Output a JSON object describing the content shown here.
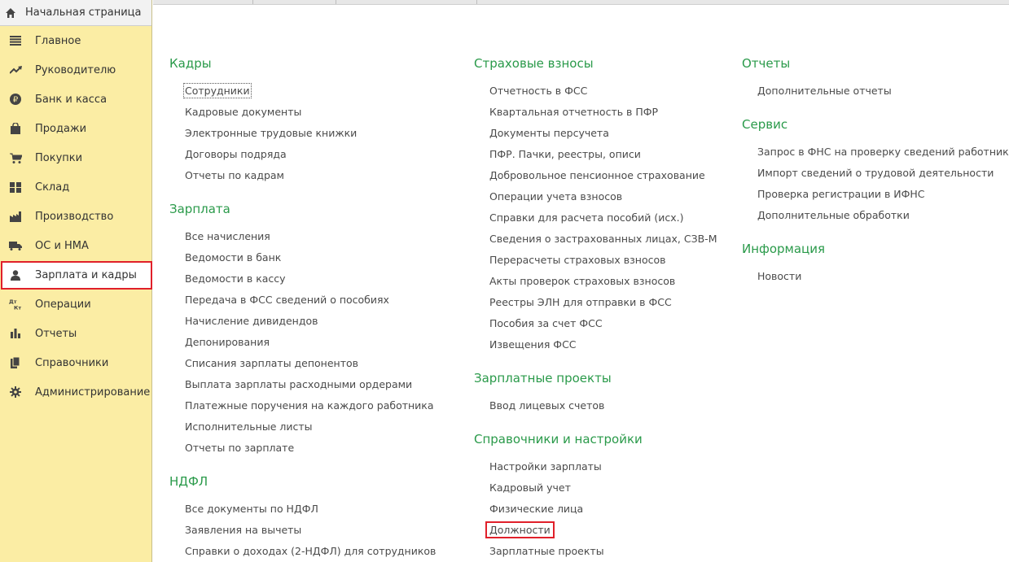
{
  "sidebar": {
    "home_label": "Начальная страница",
    "items": [
      {
        "label": "Главное",
        "icon": "menu-lines-icon"
      },
      {
        "label": "Руководителю",
        "icon": "trend-up-icon"
      },
      {
        "label": "Банк и касса",
        "icon": "ruble-coin-icon"
      },
      {
        "label": "Продажи",
        "icon": "shopping-bag-icon"
      },
      {
        "label": "Покупки",
        "icon": "cart-icon"
      },
      {
        "label": "Склад",
        "icon": "warehouse-grid-icon"
      },
      {
        "label": "Производство",
        "icon": "factory-icon"
      },
      {
        "label": "ОС и НМА",
        "icon": "truck-icon"
      },
      {
        "label": "Зарплата и кадры",
        "icon": "person-icon"
      },
      {
        "label": "Операции",
        "icon": "dt-kt-icon"
      },
      {
        "label": "Отчеты",
        "icon": "bar-chart-icon"
      },
      {
        "label": "Справочники",
        "icon": "books-icon"
      },
      {
        "label": "Администрирование",
        "icon": "gear-icon"
      }
    ]
  },
  "sections": {
    "kadry": {
      "title": "Кадры",
      "links": [
        "Сотрудники",
        "Кадровые документы",
        "Электронные трудовые книжки",
        "Договоры подряда",
        "Отчеты по кадрам"
      ]
    },
    "zarplata": {
      "title": "Зарплата",
      "links": [
        "Все начисления",
        "Ведомости в банк",
        "Ведомости в кассу",
        "Передача в ФСС сведений о пособиях",
        "Начисление дивидендов",
        "Депонирования",
        "Списания зарплаты депонентов",
        "Выплата зарплаты расходными ордерами",
        "Платежные поручения на каждого работника",
        "Исполнительные листы",
        "Отчеты по зарплате"
      ]
    },
    "ndfl": {
      "title": "НДФЛ",
      "links": [
        "Все документы по НДФЛ",
        "Заявления на вычеты",
        "Справки о доходах (2-НДФЛ) для сотрудников"
      ]
    },
    "strah": {
      "title": "Страховые взносы",
      "links": [
        "Отчетность в ФСС",
        "Квартальная отчетность в ПФР",
        "Документы персучета",
        "ПФР. Пачки, реестры, описи",
        "Добровольное пенсионное страхование",
        "Операции учета взносов",
        "Справки для расчета пособий (исх.)",
        "Сведения о застрахованных лицах, СЗВ-М",
        "Перерасчеты страховых взносов",
        "Акты проверок страховых взносов",
        "Реестры ЭЛН для отправки в ФСС",
        "Пособия за счет ФСС",
        "Извещения ФСС"
      ]
    },
    "zpproekty": {
      "title": "Зарплатные проекты",
      "links": [
        "Ввод лицевых счетов"
      ]
    },
    "sprav": {
      "title": "Справочники и настройки",
      "links": [
        "Настройки зарплаты",
        "Кадровый учет",
        "Физические лица",
        "Должности",
        "Зарплатные проекты"
      ]
    },
    "otchety": {
      "title": "Отчеты",
      "links": [
        "Дополнительные отчеты"
      ]
    },
    "servis": {
      "title": "Сервис",
      "links": [
        "Запрос в ФНС на проверку сведений работников",
        "Импорт сведений о трудовой деятельности",
        "Проверка регистрации в ИФНС",
        "Дополнительные обработки"
      ]
    },
    "info": {
      "title": "Информация",
      "links": [
        "Новости"
      ]
    }
  },
  "colors": {
    "sidebar_bg": "#fbeda4",
    "section_title": "#2a9a4a",
    "highlight_border": "#e0202a"
  }
}
